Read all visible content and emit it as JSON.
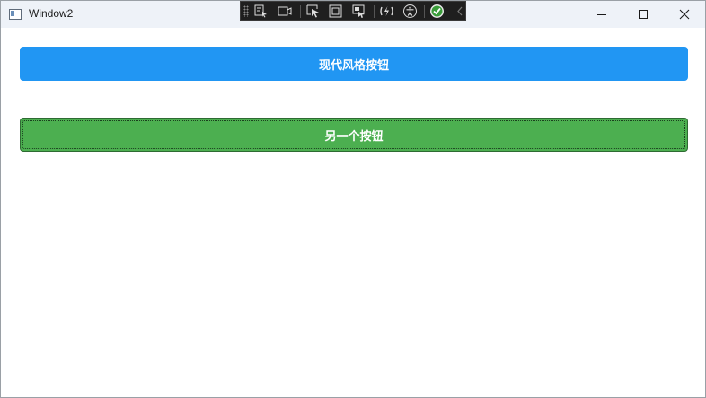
{
  "window": {
    "title": "Window2"
  },
  "debug_toolbar": {
    "icons": [
      "select-element-icon",
      "preview-icon",
      "track-focus-icon",
      "display-layout-icon",
      "display-adorners-icon",
      "hot-reload-icon",
      "accessibility-icon",
      "checkmark-icon",
      "collapse-chevron-icon"
    ]
  },
  "controls": {
    "minimize": "minimize-icon",
    "maximize": "maximize-icon",
    "close": "close-icon"
  },
  "buttons": {
    "modern_label": "现代风格按钮",
    "other_label": "另一个按钮"
  },
  "colors": {
    "modern_button": "#2196f3",
    "other_button": "#4caf50",
    "titlebar": "#eef2f8"
  }
}
